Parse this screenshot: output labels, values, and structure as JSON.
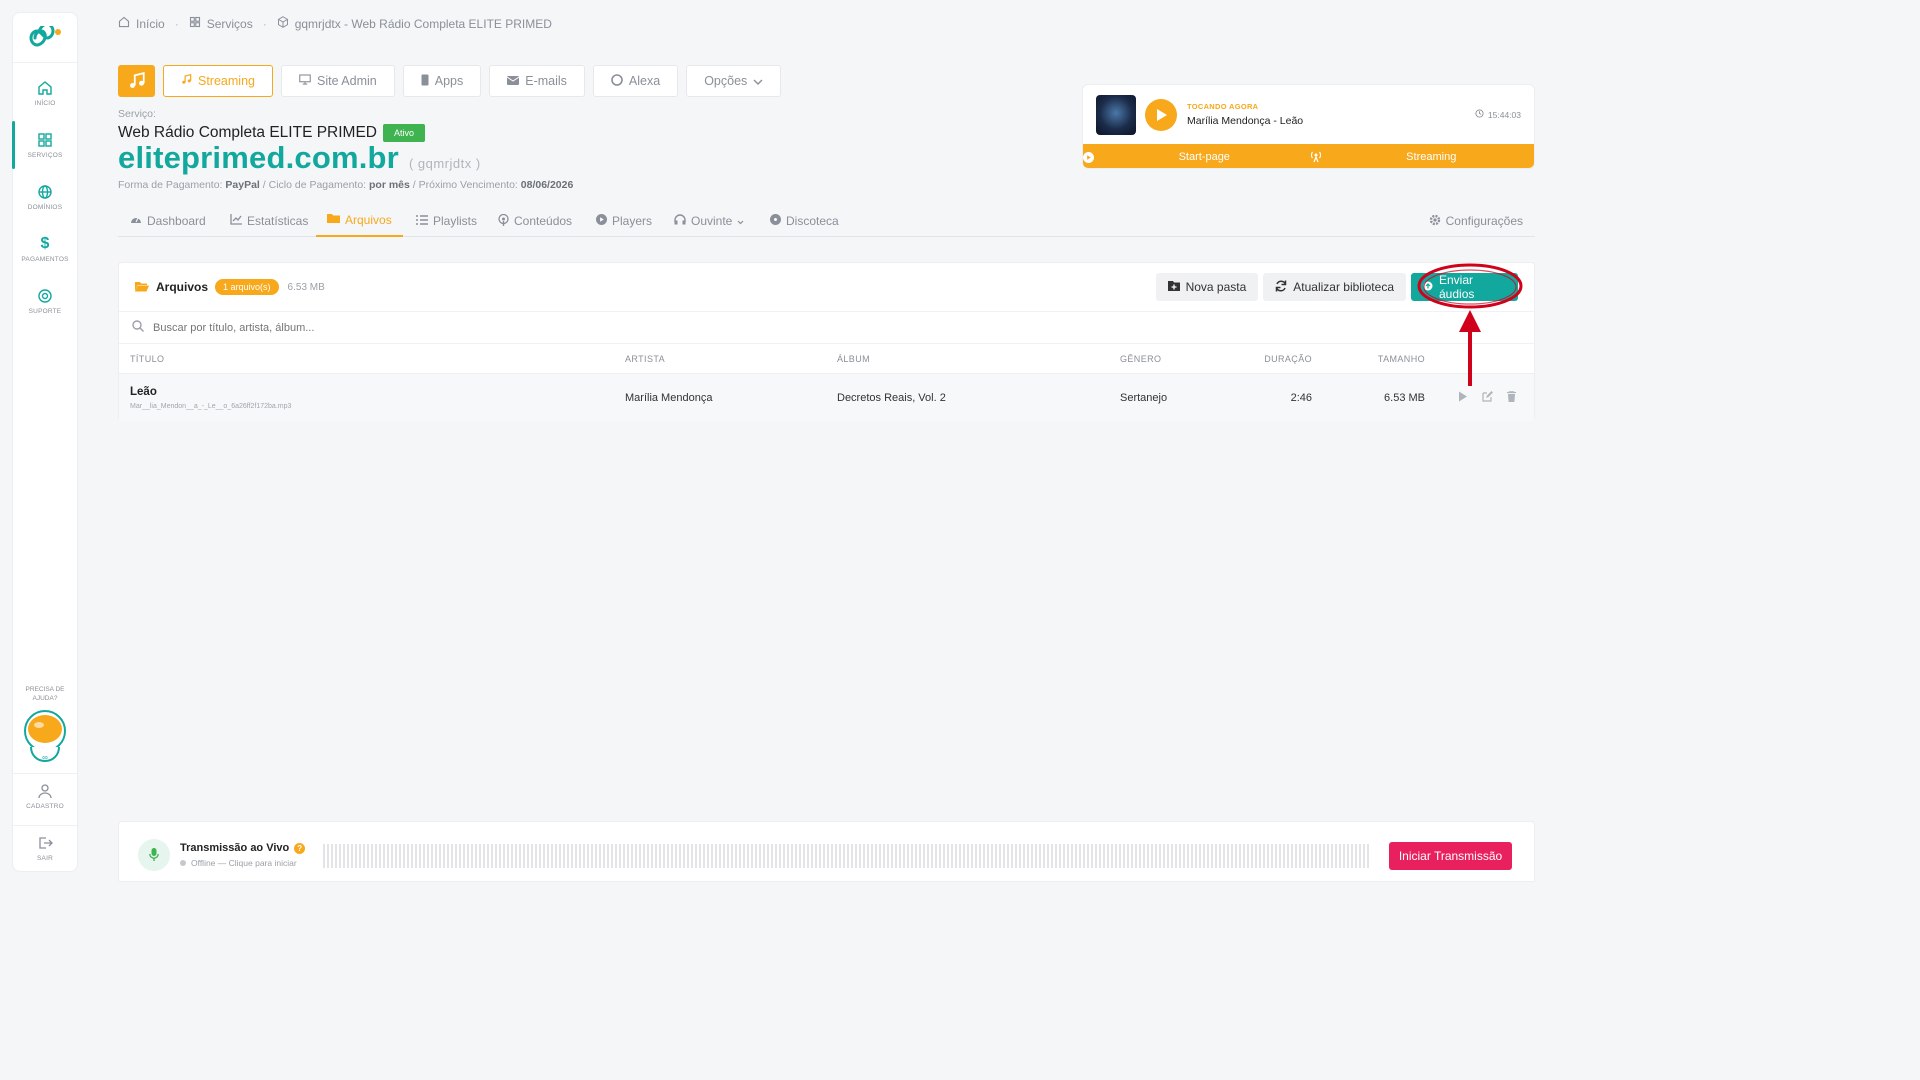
{
  "sidebar": {
    "items": [
      {
        "label": "INÍCIO"
      },
      {
        "label": "SERVIÇOS"
      },
      {
        "label": "DOMÍNIOS"
      },
      {
        "label": "PAGAMENTOS"
      },
      {
        "label": "SUPORTE"
      }
    ],
    "help_text": "PRECISA DE AJUDA?",
    "profile_label": "CADASTRO",
    "logout_label": "SAIR"
  },
  "breadcrumb": {
    "home": "Início",
    "services": "Serviços",
    "current": "gqmrjdtx - Web Rádio Completa ELITE PRIMED"
  },
  "top_tabs": {
    "streaming": "Streaming",
    "site_admin": "Site Admin",
    "apps": "Apps",
    "emails": "E-mails",
    "alexa": "Alexa",
    "options": "Opções"
  },
  "service": {
    "label": "Serviço:",
    "name": "Web Rádio Completa ELITE PRIMED",
    "status": "Ativo",
    "domain": "eliteprimed.com.br",
    "slug": "( gqmrjdtx )",
    "payment_prefix": "Forma de Pagamento:",
    "payment_method": "PayPal",
    "cycle_prefix": "/ Ciclo de Pagamento:",
    "cycle": "por mês",
    "due_prefix": "/ Próximo Vencimento:",
    "due_date": "08/06/2026"
  },
  "now_playing": {
    "label": "TOCANDO AGORA",
    "track": "Marília Mendonça - Leão",
    "time": "15:44:03",
    "start_page": "Start-page",
    "streaming": "Streaming"
  },
  "sub_tabs": {
    "dashboard": "Dashboard",
    "stats": "Estatísticas",
    "files": "Arquivos",
    "playlists": "Playlists",
    "contents": "Conteúdos",
    "players": "Players",
    "listener": "Ouvinte",
    "discoteca": "Discoteca",
    "settings": "Configurações"
  },
  "files": {
    "title": "Arquivos",
    "count": "1 arquivo(s)",
    "size": "6.53 MB",
    "new_folder": "Nova pasta",
    "refresh": "Atualizar biblioteca",
    "upload": "Enviar áudios",
    "search_placeholder": "Buscar por título, artista, álbum...",
    "columns": {
      "title": "TÍTULO",
      "artist": "ARTISTA",
      "album": "ÁLBUM",
      "genre": "GÊNERO",
      "duration": "DURAÇÃO",
      "size": "TAMANHO"
    },
    "rows": [
      {
        "title": "Leão",
        "filename": "Mar__lia_Mendon__a_-_Le__o_6a26ff2f172ba.mp3",
        "artist": "Marília Mendonça",
        "album": "Decretos Reais, Vol. 2",
        "genre": "Sertanejo",
        "duration": "2:46",
        "size": "6.53 MB"
      }
    ]
  },
  "live": {
    "title": "Transmissão ao Vivo",
    "status": "Offline — Clique para iniciar",
    "button": "Iniciar Transmissão"
  },
  "colors": {
    "accent_orange": "#f7a81b",
    "accent_green": "#13a89e",
    "annotation_red": "#d0021b",
    "live_button": "#e8205e"
  }
}
